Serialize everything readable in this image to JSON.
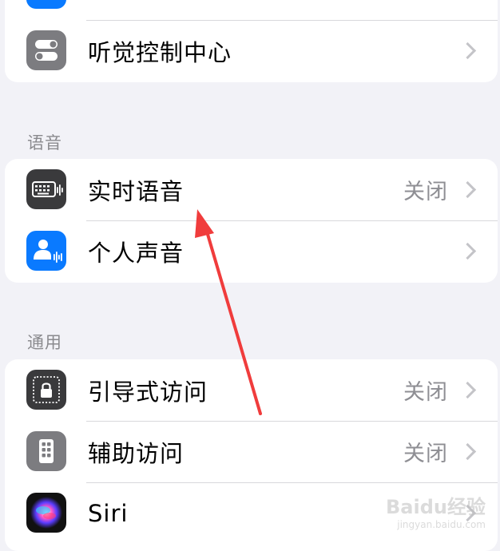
{
  "groups": {
    "top": {
      "rows": [
        {
          "label": "",
          "icon": "blue-app-icon"
        },
        {
          "label": "听觉控制中心",
          "icon": "toggle-switches-icon",
          "value": ""
        }
      ]
    },
    "speech": {
      "header": "语音",
      "rows": [
        {
          "label": "实时语音",
          "icon": "keyboard-waveform-icon",
          "value": "关闭"
        },
        {
          "label": "个人声音",
          "icon": "person-waveform-icon",
          "value": ""
        }
      ]
    },
    "general": {
      "header": "通用",
      "rows": [
        {
          "label": "引导式访问",
          "icon": "guided-access-lock-icon",
          "value": "关闭"
        },
        {
          "label": "辅助访问",
          "icon": "assistive-access-icon",
          "value": "关闭"
        },
        {
          "label": "Siri",
          "icon": "siri-icon",
          "value": ""
        }
      ]
    }
  },
  "colors": {
    "background": "#f2f2f7",
    "annotation_arrow": "#f03c3c",
    "gray_icon": "#7c7c80",
    "blue_icon": "#0a7aff"
  },
  "watermark": {
    "brand": "Baidu经验",
    "url": "jingyan.baidu.com"
  }
}
